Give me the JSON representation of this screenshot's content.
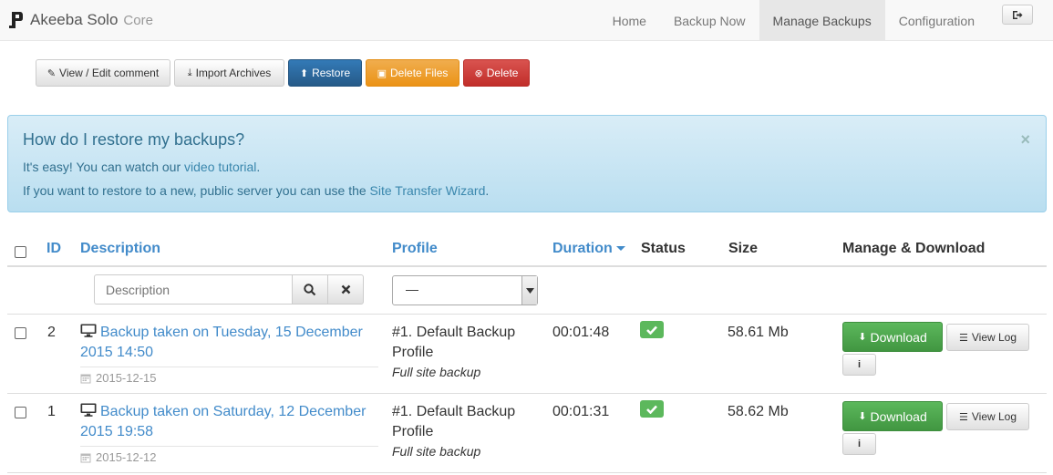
{
  "app": {
    "brand_name": "Akeeba Solo",
    "brand_sub": "Core"
  },
  "nav": {
    "items": [
      {
        "label": "Home"
      },
      {
        "label": "Backup Now"
      },
      {
        "label": "Manage Backups"
      },
      {
        "label": "Configuration"
      }
    ],
    "active": "Manage Backups"
  },
  "toolbar": {
    "view_edit_comment": "View / Edit comment",
    "import_archives": "Import Archives",
    "restore": "Restore",
    "delete_files": "Delete Files",
    "delete": "Delete"
  },
  "alert": {
    "title": "How do I restore my backups?",
    "line1_prefix": "It's easy! You can watch our ",
    "line1_link": "video tutorial",
    "line1_suffix": ".",
    "line2_prefix": "If you want to restore to a new, public server you can use the ",
    "line2_link": "Site Transfer Wizard",
    "line2_suffix": ".",
    "close": "×"
  },
  "table": {
    "headers": {
      "id": "ID",
      "description": "Description",
      "profile": "Profile",
      "duration": "Duration",
      "status": "Status",
      "size": "Size",
      "manage": "Manage & Download"
    },
    "filter": {
      "description_placeholder": "Description",
      "profile_selected": "—"
    },
    "rows": [
      {
        "id": "2",
        "description": "Backup taken on Tuesday, 15 December 2015 14:50",
        "date": "2015-12-15",
        "profile": "#1. Default Backup Profile",
        "profile_type": "Full site backup",
        "duration": "00:01:48",
        "status": "complete",
        "size": "58.61 Mb",
        "download": "Download",
        "view_log": "View Log",
        "info": "i"
      },
      {
        "id": "1",
        "description": "Backup taken on Saturday, 12 December 2015 19:58",
        "date": "2015-12-12",
        "profile": "#1. Default Backup Profile",
        "profile_type": "Full site backup",
        "duration": "00:01:31",
        "status": "complete",
        "size": "58.62 Mb",
        "download": "Download",
        "view_log": "View Log",
        "info": "i"
      }
    ]
  },
  "colors": {
    "link": "#428bca",
    "primary": "#337ab7",
    "warning": "#f0ad4e",
    "danger": "#d9534f",
    "success": "#5cb85c",
    "info_bg": "#d9edf7",
    "info_text": "#31708f"
  }
}
